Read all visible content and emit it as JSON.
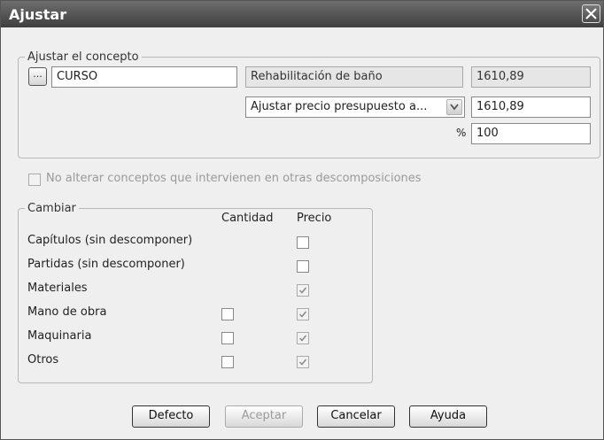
{
  "window": {
    "title": "Ajustar",
    "close_icon": "close-icon"
  },
  "concept_group": {
    "legend": "Ajustar el concepto",
    "ellipsis_label": "...",
    "code_value": "CURSO",
    "description": "Rehabilitación de baño",
    "current_price": "1610,89",
    "adjust_mode": "Ajustar precio presupuesto a...",
    "target_price": "1610,89",
    "percent_symbol": "%",
    "percent_value": "100"
  },
  "no_alter": {
    "label": "No alterar conceptos que intervienen en otras descomposiciones",
    "checked": false,
    "enabled": false
  },
  "change_group": {
    "legend": "Cambiar",
    "col_quantity": "Cantidad",
    "col_price": "Precio",
    "rows": [
      {
        "label": "Capítulos (sin descomponer)",
        "quantity": null,
        "price": false,
        "price_enabled": true
      },
      {
        "label": "Partidas (sin descomponer)",
        "quantity": null,
        "price": false,
        "price_enabled": true
      },
      {
        "label": "Materiales",
        "quantity": null,
        "price": true,
        "price_enabled": false
      },
      {
        "label": "Mano de obra",
        "quantity": false,
        "price": true,
        "price_enabled": false
      },
      {
        "label": "Maquinaria",
        "quantity": false,
        "price": true,
        "price_enabled": false
      },
      {
        "label": "Otros",
        "quantity": false,
        "price": true,
        "price_enabled": false
      }
    ]
  },
  "buttons": {
    "default": "Defecto",
    "accept": "Aceptar",
    "cancel": "Cancelar",
    "help": "Ayuda"
  }
}
